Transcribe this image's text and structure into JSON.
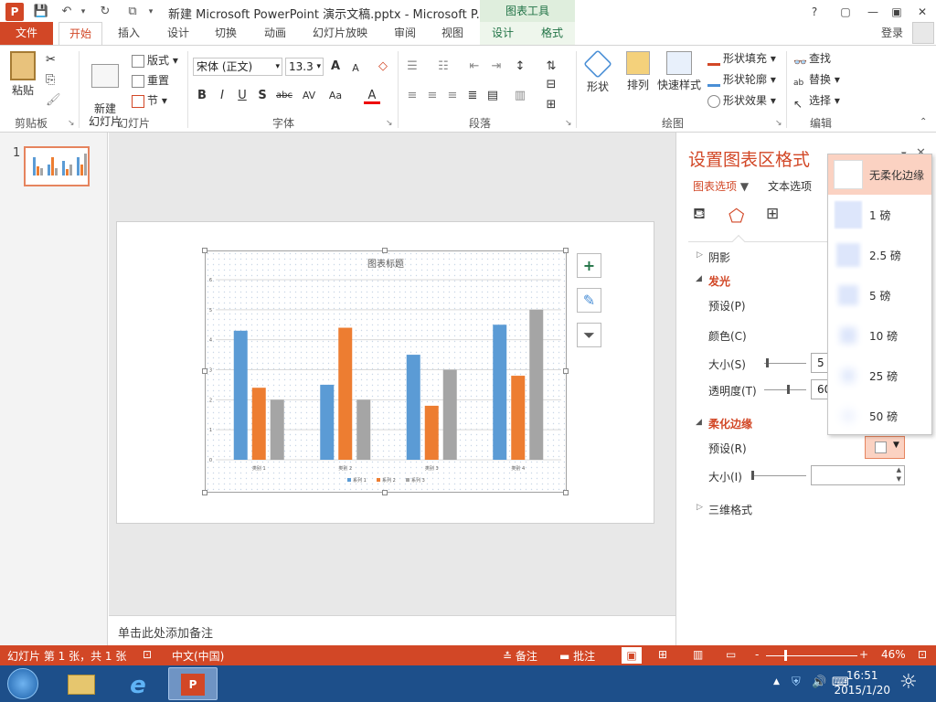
{
  "titlebar": {
    "app_icon": "P",
    "title": "新建 Microsoft PowerPoint 演示文稿.pptx - Microsoft P...",
    "context_tab_group": "图表工具",
    "help": "?",
    "restore_ribbon": "▢",
    "minimize": "—",
    "maximize": "▣",
    "close": "✕"
  },
  "tabs": {
    "file": "文件",
    "items": [
      "开始",
      "插入",
      "设计",
      "切换",
      "动画",
      "幻灯片放映",
      "审阅",
      "视图",
      "设计",
      "格式"
    ],
    "login": "登录"
  },
  "ribbon": {
    "clipboard": {
      "paste": "粘贴",
      "group": "剪贴板"
    },
    "slides": {
      "new_slide": "新建\n幻灯片",
      "layout": "版式",
      "reset": "重置",
      "section": "节",
      "group": "幻灯片"
    },
    "font": {
      "name": "宋体 (正文)",
      "size": "13.3",
      "bold": "B",
      "italic": "I",
      "underline": "U",
      "shadow": "S",
      "strike": "abc",
      "spacing": "AV",
      "case": "Aa",
      "color": "A",
      "grow": "A",
      "shrink": "A",
      "group": "字体"
    },
    "paragraph": {
      "group": "段落"
    },
    "drawing": {
      "shapes": "形状",
      "arrange": "排列",
      "quick_styles": "快速样式",
      "fill": "形状填充",
      "outline": "形状轮廓",
      "effects": "形状效果",
      "group": "绘图"
    },
    "editing": {
      "find": "查找",
      "replace": "替换",
      "select": "选择",
      "group": "编辑"
    }
  },
  "thumbnails": {
    "slide_number": "1"
  },
  "notes": {
    "placeholder": "单击此处添加备注"
  },
  "chart_data": {
    "type": "bar",
    "title": "图表标题",
    "categories": [
      "类别 1",
      "类别 2",
      "类别 3",
      "类别 4"
    ],
    "series": [
      {
        "name": "系列 1",
        "values": [
          4.3,
          2.5,
          3.5,
          4.5
        ],
        "color": "#5b9bd5"
      },
      {
        "name": "系列 2",
        "values": [
          2.4,
          4.4,
          1.8,
          2.8
        ],
        "color": "#ed7d31"
      },
      {
        "name": "系列 3",
        "values": [
          2.0,
          2.0,
          3.0,
          5.0
        ],
        "color": "#a5a5a5"
      }
    ],
    "ylim": [
      0,
      6
    ],
    "yticks": [
      "0",
      "1",
      "2",
      "3",
      "4",
      "5",
      "6"
    ],
    "grid": true,
    "legend": "bottom"
  },
  "chart_side_buttons": {
    "add": "+",
    "style": "brush-icon",
    "filter": "filter-icon"
  },
  "pane": {
    "title": "设置图表区格式",
    "tab_chart": "图表选项",
    "tab_text": "文本选项",
    "sections": {
      "shadow": "阴影",
      "glow": "发光",
      "glow_preset": "预设(P)",
      "glow_color": "颜色(C)",
      "glow_size": "大小(S)",
      "glow_size_val": "5",
      "glow_transparency": "透明度(T)",
      "glow_transparency_val": "60",
      "soft_edges": "柔化边缘",
      "soft_preset": "预设(R)",
      "soft_size": "大小(I)",
      "three_d": "三维格式"
    }
  },
  "dropdown": {
    "items": [
      "无柔化边缘",
      "1 磅",
      "2.5 磅",
      "5 磅",
      "10 磅",
      "25 磅",
      "50 磅"
    ]
  },
  "statusbar": {
    "slide_info": "幻灯片 第 1 张，共 1 张",
    "language": "中文(中国)",
    "notes": "备注",
    "comments": "批注",
    "zoom_minus": "-",
    "zoom_plus": "+",
    "zoom": "46%"
  },
  "taskbar": {
    "time": "16:51",
    "date": "2015/1/20"
  },
  "colors": {
    "accent": "#d24726",
    "chart_tools": "#217346"
  }
}
